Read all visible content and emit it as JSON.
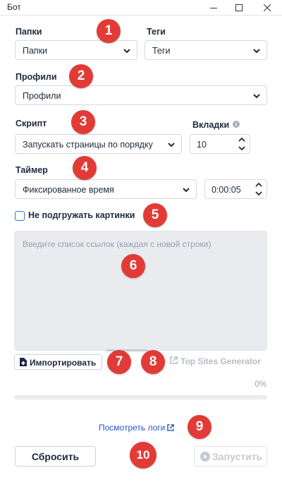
{
  "window": {
    "title": "Бот"
  },
  "folders": {
    "label": "Папки",
    "value": "Папки"
  },
  "tags": {
    "label": "Теги",
    "value": "Теги"
  },
  "profiles": {
    "label": "Профили",
    "value": "Профили"
  },
  "script": {
    "label": "Скрипт",
    "value": "Запускать страницы по порядку"
  },
  "tabs": {
    "label": "Вкладки",
    "value": "10"
  },
  "timer": {
    "label": "Таймер",
    "value": "Фиксированное время",
    "time": "0:00:05"
  },
  "images": {
    "label": "Не подгружать картинки",
    "checked": false
  },
  "links": {
    "placeholder": "Введите список ссылок (каждая с новой строки)"
  },
  "import_label": "Импортировать",
  "top_sites_label": "Top Sites Generator",
  "progress": {
    "text": "0%",
    "value": 0
  },
  "logs_label": "Посмотреть логи",
  "reset_label": "Сбросить",
  "run_label": "Запустить",
  "badges": [
    "1",
    "2",
    "3",
    "4",
    "5",
    "6",
    "7",
    "8",
    "9",
    "10"
  ],
  "colors": {
    "accent": "#3a6fd8",
    "badge": "#e23b36",
    "link": "#2456c8",
    "disabled": "#c5cad2"
  },
  "icons": [
    "minimize-icon",
    "maximize-icon",
    "close-icon",
    "chevron-down-icon",
    "chevron-up-icon",
    "info-icon",
    "file-icon",
    "external-link-icon",
    "play-icon"
  ]
}
